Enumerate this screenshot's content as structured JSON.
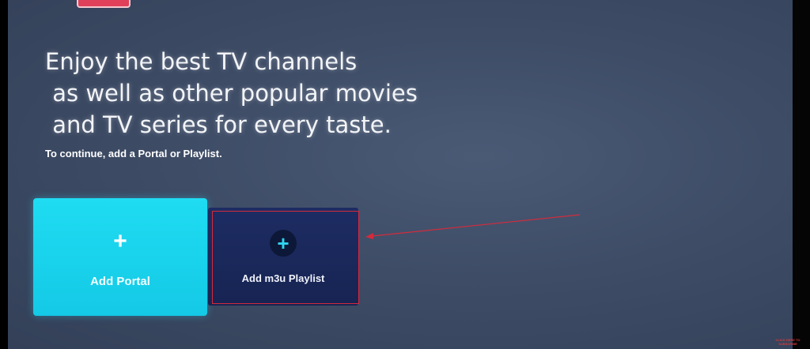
{
  "headline": {
    "line1": "Enjoy the best TV channels",
    "line2": " as well as other popular movies",
    "line3": " and TV series for every taste."
  },
  "subtext": "To continue, add a Portal or Playlist.",
  "tiles": [
    {
      "label": "Add Portal",
      "icon": "plus-icon",
      "selected": true
    },
    {
      "label": "Add m3u Playlist",
      "icon": "plus-icon",
      "selected": false
    }
  ],
  "icon_glyph": "+",
  "subscribe_overlay": {
    "line1": "CLICK HERE TO",
    "line2": "SUBSCRIBE"
  },
  "colors": {
    "screen_bg": "#3e4c66",
    "portal_tile": "#1fdcf2",
    "playlist_tile": "#1d2c63",
    "annotation_red": "#d42b3c"
  }
}
